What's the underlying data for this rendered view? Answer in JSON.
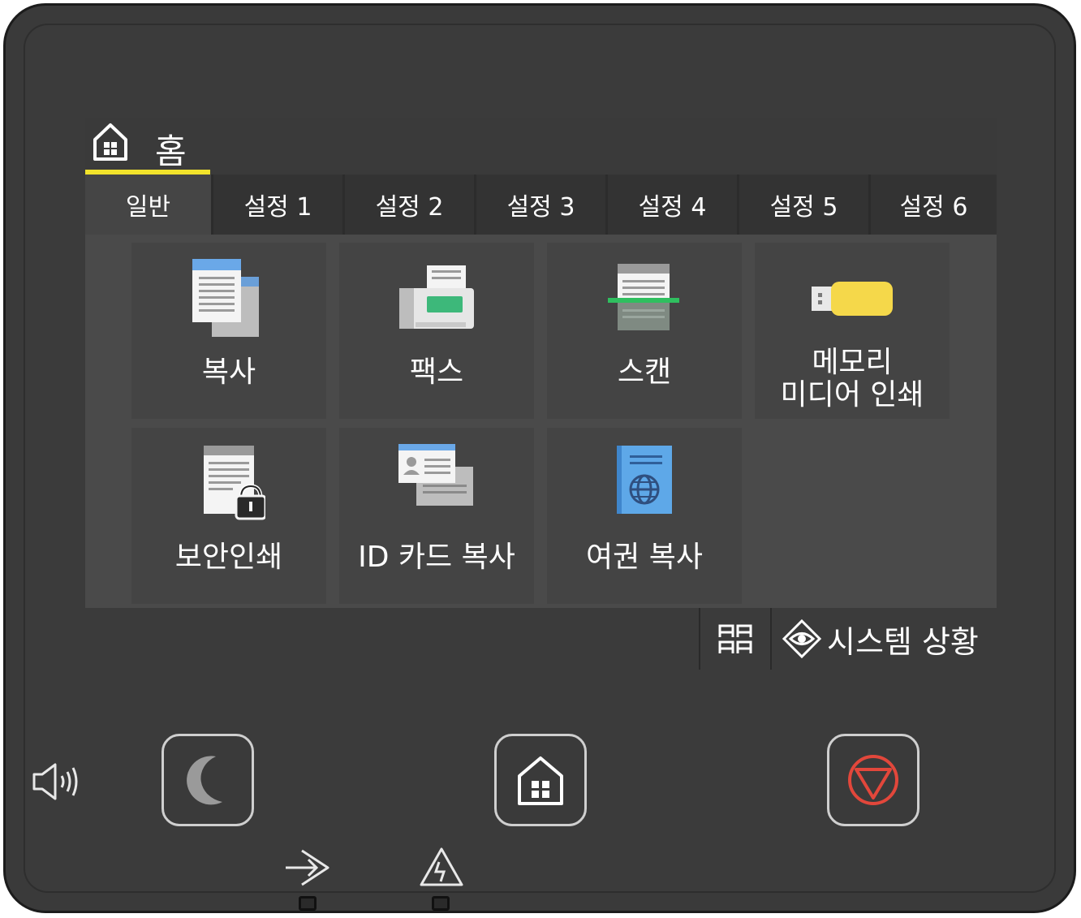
{
  "header": {
    "title": "홈"
  },
  "tabs": [
    "일반",
    "설정 1",
    "설정 2",
    "설정 3",
    "설정 4",
    "설정 5",
    "설정 6"
  ],
  "tiles": [
    {
      "label": "복사",
      "icon": "copy-icon"
    },
    {
      "label": "팩스",
      "icon": "fax-icon"
    },
    {
      "label": "스캔",
      "icon": "scan-icon"
    },
    {
      "label_line1": "메모리",
      "label_line2": "미디어 인쇄",
      "icon": "usb-memory-icon"
    },
    {
      "label": "보안인쇄",
      "icon": "secure-print-icon"
    },
    {
      "label": "ID 카드 복사",
      "icon": "id-card-copy-icon"
    },
    {
      "label": "여권 복사",
      "icon": "passport-copy-icon"
    }
  ],
  "bottom_bar": {
    "status_label": "시스템 상황"
  },
  "colors": {
    "accent_yellow": "#f2e32b",
    "stop_red": "#e2473b",
    "fax_green": "#3db87a",
    "scan_green": "#2fbf5f",
    "usb_yellow": "#f5d84a",
    "passport_blue": "#5ea8e8"
  }
}
